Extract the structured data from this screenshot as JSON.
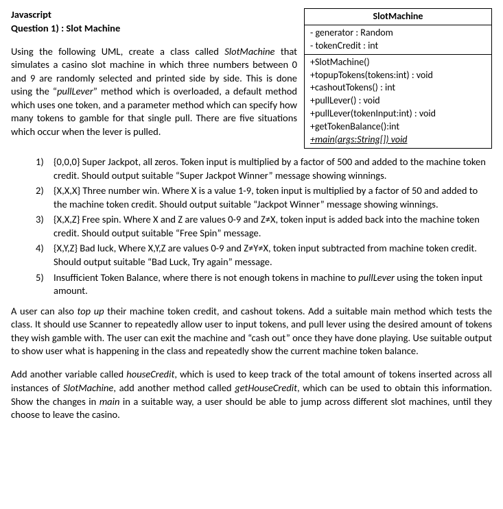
{
  "header": {
    "line1": "Javascript",
    "line2": "Question 1) : Slot Machine"
  },
  "intro": {
    "p1a": "Using the following UML, create a class called ",
    "p1_ital": "SlotMachine",
    "p1b": " that simulates a casino slot machine in which three numbers between 0 and 9 are randomly selected and printed side by side. This is done using the “",
    "p1_ital2": "pullLever",
    "p1c": "” method which is overloaded, a default method which uses one token, and a parameter method which can specify how many tokens to gamble for that single pull. There are five situations which occur when the lever is pulled."
  },
  "uml": {
    "title": "SlotMachine",
    "attrs": [
      "- generator : Random",
      "- tokenCredit : int"
    ],
    "methods": [
      "+SlotMachine()",
      "+topupTokens(tokens:int) : void",
      "+cashoutTokens() : int",
      "+pullLever() : void",
      "+pullLever(tokenInput:int) : void",
      "+getTokenBalance():int"
    ],
    "method_main": "+main(args:String[]) void"
  },
  "list": {
    "n1": "1)",
    "i1": "{0,0,0} Super Jackpot, all zeros. Token input is multiplied by a factor of 500 and added to the machine token credit. Should output suitable “Super Jackpot Winner” message showing winnings.",
    "n2": "2)",
    "i2": "{X,X,X} Three number win. Where X is a value 1-9, token input is multiplied by a factor of 50 and added to the machine token credit. Should output suitable “Jackpot Winner” message showing winnings.",
    "n3": "3)",
    "i3": "{X,X,Z} Free spin. Where X and Z are values 0-9 and Z≠X, token input is added back into the machine token credit. Should output suitable “Free Spin” message.",
    "n4": "4)",
    "i4": "{X,Y,Z} Bad luck, Where X,Y,Z are values 0-9 and Z≠Y≠X, token input subtracted from machine token credit. Should output suitable “Bad Luck, Try again” message.",
    "n5": "5)",
    "i5a": "Insufficient Token Balance, where there is not enough tokens in machine to ",
    "i5_ital": "pullLever",
    "i5b": " using the token input amount."
  },
  "para2": {
    "a": "A user can also ",
    "ital1": "top up",
    "b": " their machine token credit, and cashout tokens. Add a suitable main method which tests the class. It should use Scanner to repeatedly allow user to input tokens, and pull lever using the desired amount of tokens they wish gamble with. The user can exit the machine and “cash out” once they have done playing. Use suitable output to show user what is happening in the class and repeatedly show the current machine token balance."
  },
  "para3": {
    "a": "Add another variable called ",
    "ital1": "houseCredit",
    "b": ", which is used to keep track of the total amount of tokens inserted across all instances of ",
    "ital2": "SlotMachine",
    "c": ", add another method called ",
    "ital3": "getHouseCredit",
    "d": ", which can be used to obtain this information.  Show the changes in ",
    "ital4": "main",
    "e": " in a suitable way, a user should be able to jump across different slot machines, until they choose to leave the casino."
  }
}
